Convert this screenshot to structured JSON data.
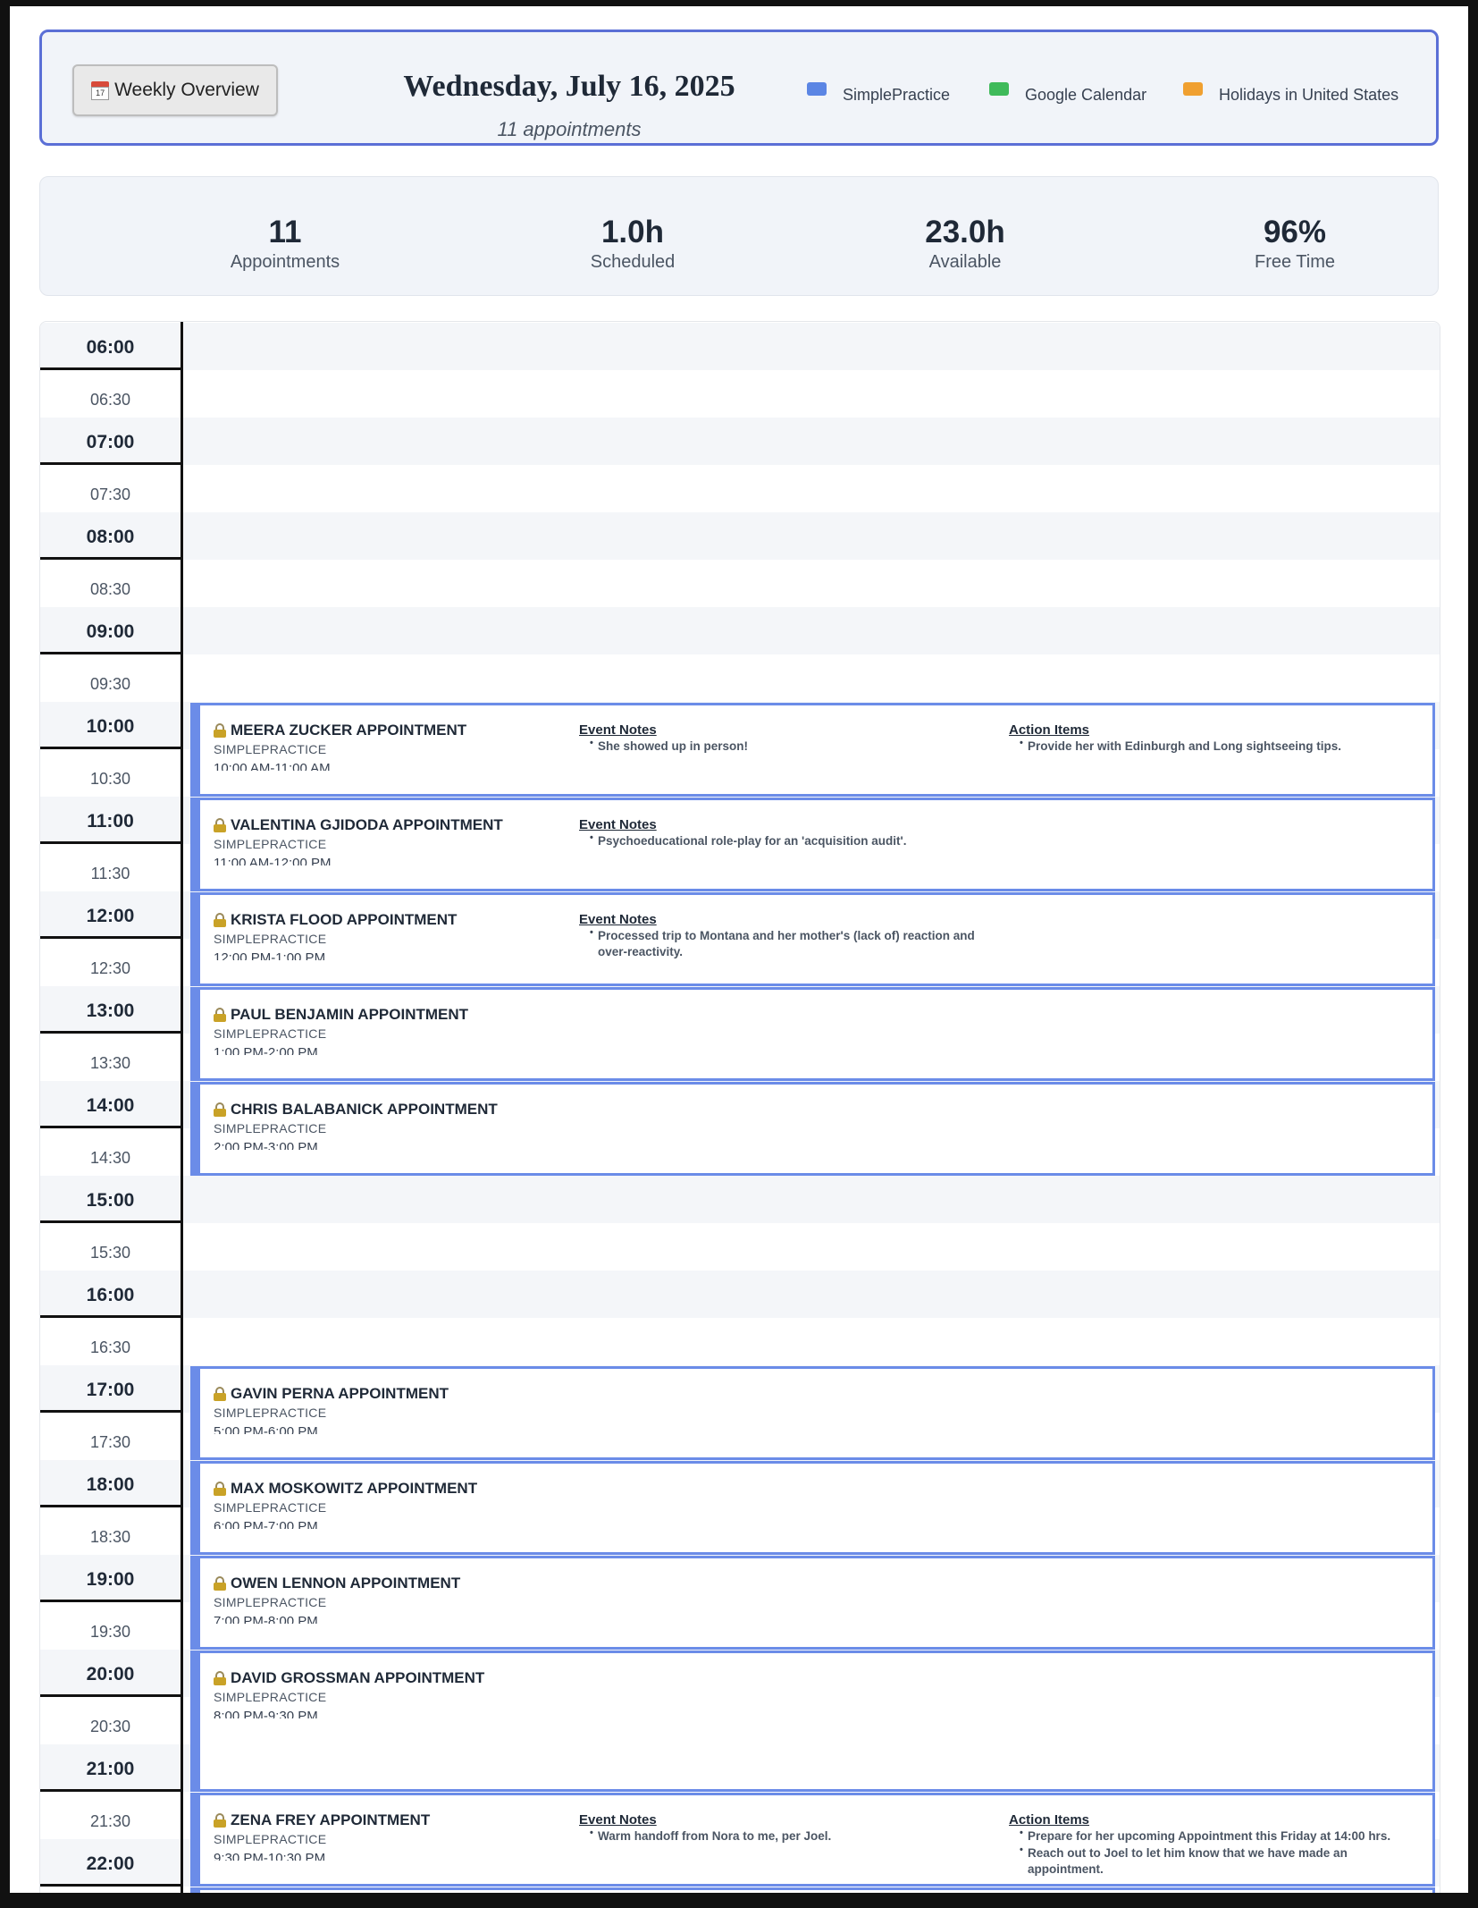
{
  "header": {
    "weekly_button_label": "Weekly Overview",
    "calendar_icon_day": "17",
    "date_title": "Wednesday, July 16, 2025",
    "appointment_count": "11 appointments",
    "legend": [
      {
        "label": "SimplePractice",
        "color": "#5b85e4"
      },
      {
        "label": "Google Calendar",
        "color": "#3fba5a"
      },
      {
        "label": "Holidays in United States",
        "color": "#f0a030"
      }
    ]
  },
  "stats": [
    {
      "value": "11",
      "label": "Appointments"
    },
    {
      "value": "1.0h",
      "label": "Scheduled"
    },
    {
      "value": "23.0h",
      "label": "Available"
    },
    {
      "value": "96%",
      "label": "Free Time"
    }
  ],
  "time_slots": [
    "06:00",
    "06:30",
    "07:00",
    "07:30",
    "08:00",
    "08:30",
    "09:00",
    "09:30",
    "10:00",
    "10:30",
    "11:00",
    "11:30",
    "12:00",
    "12:30",
    "13:00",
    "13:30",
    "14:00",
    "14:30",
    "15:00",
    "15:30",
    "16:00",
    "16:30",
    "17:00",
    "17:30",
    "18:00",
    "18:30",
    "19:00",
    "19:30",
    "20:00",
    "20:30",
    "21:00",
    "21:30",
    "22:00"
  ],
  "appointments": [
    {
      "title": "MEERA ZUCKER APPOINTMENT",
      "source": "SIMPLEPRACTICE",
      "time": "10:00 AM-11:00 AM",
      "start_slot": "10:00",
      "slots": 2,
      "event_notes_label": "Event Notes",
      "event_notes": [
        "She showed up in person!"
      ],
      "action_items_label": "Action Items",
      "action_items": [
        "Provide her with Edinburgh and Long sightseeing tips."
      ]
    },
    {
      "title": "VALENTINA GJIDODA APPOINTMENT",
      "source": "SIMPLEPRACTICE",
      "time": "11:00 AM-12:00 PM",
      "start_slot": "11:00",
      "slots": 2,
      "event_notes_label": "Event Notes",
      "event_notes": [
        "Psychoeducational role-play for an 'acquisition audit'."
      ]
    },
    {
      "title": "KRISTA FLOOD APPOINTMENT",
      "source": "SIMPLEPRACTICE",
      "time": "12:00 PM-1:00 PM",
      "start_slot": "12:00",
      "slots": 2,
      "event_notes_label": "Event Notes",
      "event_notes": [
        "Processed trip to Montana and her mother's (lack of) reaction and over-reactivity."
      ]
    },
    {
      "title": "PAUL BENJAMIN APPOINTMENT",
      "source": "SIMPLEPRACTICE",
      "time": "1:00 PM-2:00 PM",
      "start_slot": "13:00",
      "slots": 2
    },
    {
      "title": "CHRIS BALABANICK APPOINTMENT",
      "source": "SIMPLEPRACTICE",
      "time": "2:00 PM-3:00 PM",
      "start_slot": "14:00",
      "slots": 2
    },
    {
      "title": "GAVIN PERNA APPOINTMENT",
      "source": "SIMPLEPRACTICE",
      "time": "5:00 PM-6:00 PM",
      "start_slot": "17:00",
      "slots": 2
    },
    {
      "title": "MAX MOSKOWITZ APPOINTMENT",
      "source": "SIMPLEPRACTICE",
      "time": "6:00 PM-7:00 PM",
      "start_slot": "18:00",
      "slots": 2
    },
    {
      "title": "OWEN LENNON APPOINTMENT",
      "source": "SIMPLEPRACTICE",
      "time": "7:00 PM-8:00 PM",
      "start_slot": "19:00",
      "slots": 2
    },
    {
      "title": "DAVID GROSSMAN APPOINTMENT",
      "source": "SIMPLEPRACTICE",
      "time": "8:00 PM-9:30 PM",
      "start_slot": "20:00",
      "slots": 3
    },
    {
      "title": "ZENA FREY APPOINTMENT",
      "source": "SIMPLEPRACTICE",
      "time": "9:30 PM-10:30 PM",
      "start_slot": "21:30",
      "slots": 2,
      "event_notes_label": "Event Notes",
      "event_notes": [
        "Warm handoff from Nora to me, per Joel."
      ],
      "action_items_label": "Action Items",
      "action_items": [
        "Prepare for her upcoming Appointment this Friday at 14:00 hrs.",
        "Reach out to Joel to let him know that we have made an appointment."
      ]
    },
    {
      "title": "",
      "source": "",
      "time": "",
      "start_slot": "22:30",
      "slots": 2
    }
  ]
}
